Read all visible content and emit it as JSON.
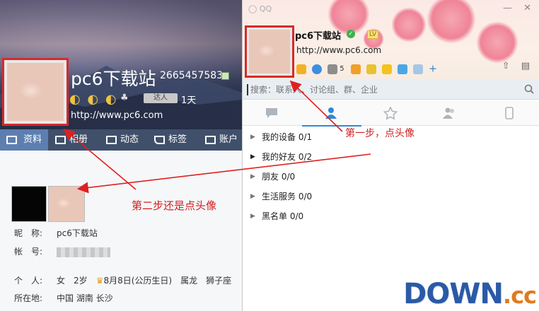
{
  "left_profile": {
    "nickname": "pc6下载站",
    "qq_number": "2665457583",
    "level_icons": "◐ ◐ ◐",
    "talent_badge": "达人",
    "online_days": "1天",
    "url": "http://www.pc6.com",
    "tabs": [
      {
        "label": "资料",
        "icon": "profile-card-icon"
      },
      {
        "label": "相册",
        "icon": "album-icon"
      },
      {
        "label": "动态",
        "icon": "feed-icon"
      },
      {
        "label": "标签",
        "icon": "tag-icon"
      },
      {
        "label": "账户",
        "icon": "briefcase-icon"
      }
    ],
    "fields": {
      "nickname_label": "昵　称:",
      "nickname_value": "pc6下载站",
      "account_label": "帐　号:",
      "personal_label": "个　人:",
      "gender": "女",
      "age": "2岁",
      "birthday": "8月8日(公历生日)",
      "zodiac": "属龙",
      "constellation": "狮子座",
      "location_label": "所在地:",
      "location_value": "中国 湖南 长沙"
    }
  },
  "right_panel": {
    "nickname": "pc6下载站",
    "url": "http://www.pc6.com",
    "app_count": "5",
    "search_placeholder": "搜索：联系人、讨论组、群、企业",
    "tabs": [
      {
        "name": "messages",
        "icon": "chat-icon"
      },
      {
        "name": "contacts",
        "icon": "contact-icon",
        "active": true
      },
      {
        "name": "favorites",
        "icon": "star-icon"
      },
      {
        "name": "groups",
        "icon": "group-icon"
      },
      {
        "name": "devices",
        "icon": "phone-icon"
      }
    ],
    "groups": [
      {
        "name": "我的设备",
        "count": "0/1"
      },
      {
        "name": "我的好友",
        "count": "0/2"
      },
      {
        "name": "朋友",
        "count": "0/0"
      },
      {
        "name": "生活服务",
        "count": "0/0"
      },
      {
        "name": "黑名单",
        "count": "0/0"
      }
    ]
  },
  "annotations": {
    "step1": "第一步，点头像",
    "step2": "第二步还是点头像"
  },
  "watermark": {
    "main": "DOWN",
    "suffix": ".cc"
  }
}
